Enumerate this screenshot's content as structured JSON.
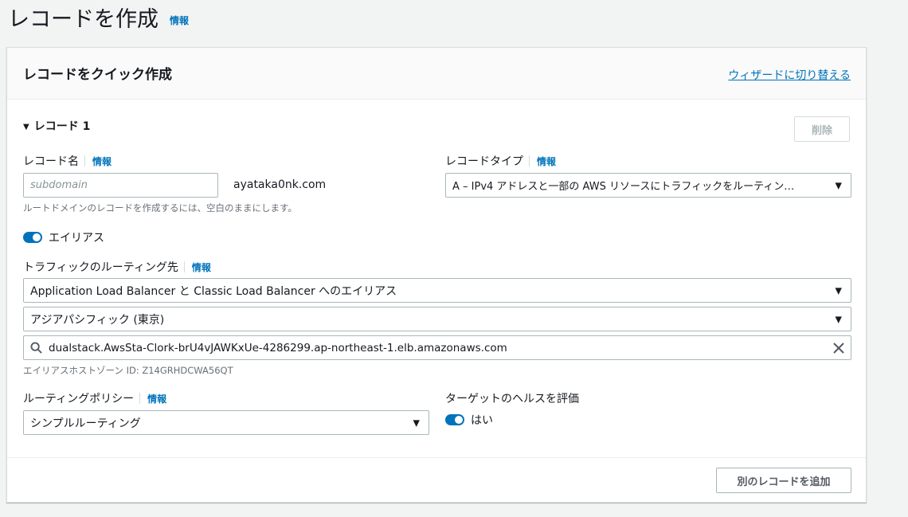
{
  "page": {
    "title": "レコードを作成",
    "info": "情報"
  },
  "panel": {
    "title": "レコードをクイック作成",
    "wizard_link": "ウィザードに切り替える",
    "record": {
      "section_title": "レコード 1",
      "delete_button": "削除",
      "record_name": {
        "label": "レコード名",
        "info": "情報",
        "placeholder": "subdomain",
        "domain_suffix": "ayataka0nk.com",
        "hint": "ルートドメインのレコードを作成するには、空白のままにします。"
      },
      "record_type": {
        "label": "レコードタイプ",
        "info": "情報",
        "value": "A – IPv4 アドレスと一部の AWS リソースにトラフィックをルーティン…"
      },
      "alias": {
        "label": "エイリアス",
        "enabled": true
      },
      "route_traffic": {
        "label": "トラフィックのルーティング先",
        "info": "情報",
        "endpoint_type": "Application Load Balancer と Classic Load Balancer へのエイリアス",
        "region": "アジアパシフィック (東京)",
        "endpoint": "dualstack.AwsSta-Clork-brU4vJAWKxUe-4286299.ap-northeast-1.elb.amazonaws.com",
        "hosted_zone_hint": "エイリアスホストゾーン ID: Z14GRHDCWA56QT"
      },
      "routing_policy": {
        "label": "ルーティングポリシー",
        "info": "情報",
        "value": "シンプルルーティング"
      },
      "health": {
        "label": "ターゲットのヘルスを評価",
        "toggle_label": "はい",
        "enabled": true
      }
    },
    "add_record_button": "別のレコードを追加"
  },
  "colors": {
    "link": "#0073bb",
    "toggle_on": "#0073bb",
    "background": "#f2f3f3"
  }
}
